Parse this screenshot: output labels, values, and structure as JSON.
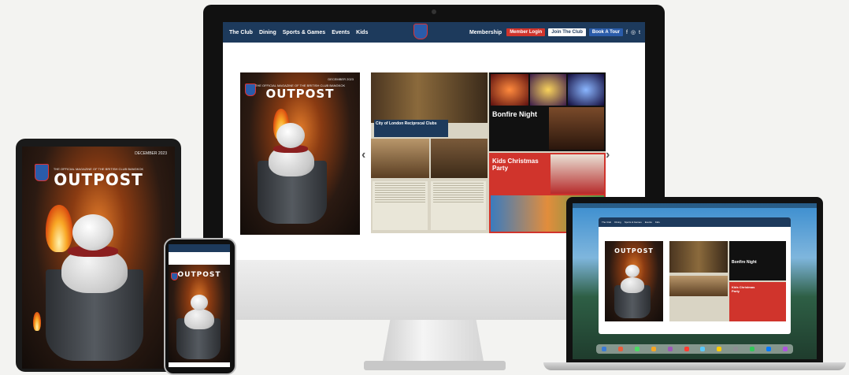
{
  "site": {
    "nav": [
      "The Club",
      "Dining",
      "Sports & Games",
      "Events",
      "Kids"
    ],
    "membership": "Membership",
    "member_login": "Member Login",
    "join": "Join The Club",
    "book_tour": "Book A Tour",
    "social": [
      "f",
      "◎",
      "t"
    ]
  },
  "magazine": {
    "issue": "DECEMBER 2023",
    "tagline": "THE OFFICIAL MAGAZINE OF THE BRITISH CLUB BANGKOK",
    "title": "OUTPOST"
  },
  "spread": {
    "article1": "City of London Reciprocal Clubs",
    "bonfire": "Bonfire Night",
    "kids_xmas": "Kids Christmas Party"
  },
  "colors": {
    "navy": "#1d3a5c",
    "red": "#d0342c",
    "accent_blue": "#2a5caa"
  }
}
